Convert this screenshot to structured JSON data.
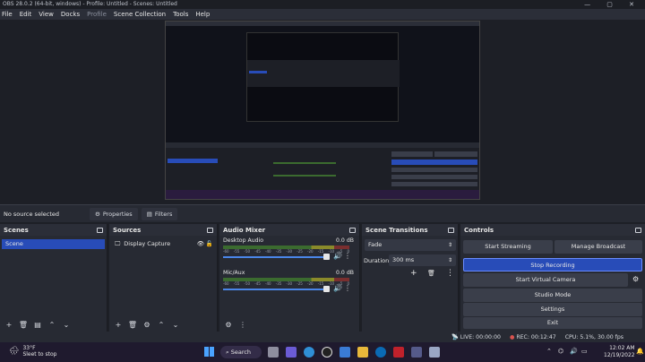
{
  "window": {
    "title": "OBS 28.0.2 (64-bit, windows) - Profile: Untitled - Scenes: Untitled"
  },
  "menu": [
    "File",
    "Edit",
    "View",
    "Docks",
    "Profile",
    "Scene Collection",
    "Tools",
    "Help"
  ],
  "source_bar": {
    "no_source": "No source selected",
    "properties": "Properties",
    "filters": "Filters"
  },
  "scenes": {
    "title": "Scenes",
    "items": [
      "Scene"
    ]
  },
  "sources": {
    "title": "Sources",
    "items": [
      "Display Capture"
    ]
  },
  "mixer": {
    "title": "Audio Mixer",
    "channels": [
      {
        "name": "Desktop Audio",
        "db": "0.0 dB"
      },
      {
        "name": "Mic/Aux",
        "db": "0.0 dB"
      }
    ],
    "ticks": [
      "-60",
      "-55",
      "-50",
      "-45",
      "-40",
      "-35",
      "-30",
      "-25",
      "-20",
      "-15",
      "-10",
      "-5",
      "0"
    ]
  },
  "transitions": {
    "title": "Scene Transitions",
    "selected": "Fade",
    "duration_label": "Duration",
    "duration_value": "300 ms"
  },
  "controls": {
    "title": "Controls",
    "start_streaming": "Start Streaming",
    "manage_broadcast": "Manage Broadcast",
    "stop_recording": "Stop Recording",
    "start_virtual_camera": "Start Virtual Camera",
    "studio_mode": "Studio Mode",
    "settings": "Settings",
    "exit": "Exit"
  },
  "status": {
    "live": "LIVE: 00:00:00",
    "rec": "REC: 00:12:47",
    "cpu": "CPU: 5.1%, 30.00 fps"
  },
  "taskbar": {
    "weather_temp": "33°F",
    "weather_desc": "Sleet to stop",
    "search": "Search",
    "time": "12:02 AM",
    "date": "12/19/2022"
  },
  "colors": {
    "accent": "#284cb8",
    "bg": "#1d1f26",
    "panel": "#272a33",
    "rec_red": "#d9534f"
  }
}
